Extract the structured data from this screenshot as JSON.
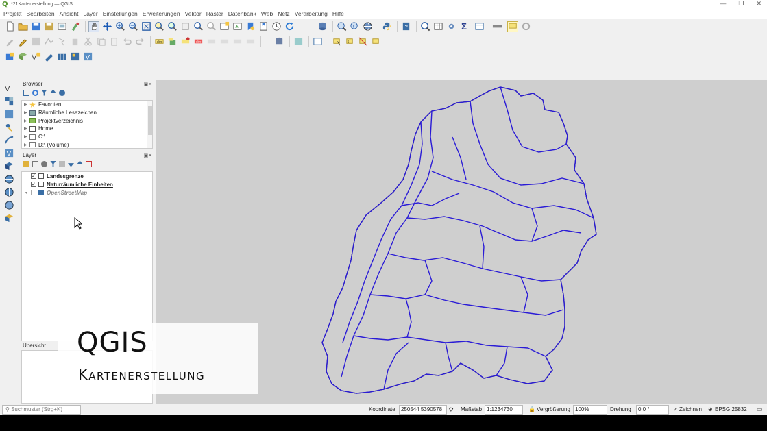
{
  "window": {
    "title": "*21Kartenerstellung — QGIS",
    "logo": "Q",
    "controls": [
      "—",
      "❐",
      "✕"
    ]
  },
  "menu": [
    "Projekt",
    "Bearbeiten",
    "Ansicht",
    "Layer",
    "Einstellungen",
    "Erweiterungen",
    "Vektor",
    "Raster",
    "Datenbank",
    "Web",
    "Netz",
    "Verarbeitung",
    "Hilfe"
  ],
  "browser": {
    "title": "Browser",
    "items": [
      "Favoriten",
      "Räumliche Lesezeichen",
      "Projektverzeichnis",
      "Home",
      "C:\\",
      "D:\\ (Volume)"
    ]
  },
  "layers": {
    "title": "Layer",
    "items": [
      {
        "label": "Landesgrenze",
        "checked": true
      },
      {
        "label": "Naturräumliche Einheiten",
        "checked": true
      },
      {
        "label": "OpenStreetMap",
        "checked": false
      }
    ]
  },
  "overview": {
    "title": "Übersicht"
  },
  "overlay": {
    "title": "QGIS",
    "subtitle": "Kartenerstellung"
  },
  "status": {
    "search_placeholder": "Suchmuster (Strg+K)",
    "coord_label": "Koordinate",
    "coord_value": "250544 5390578",
    "scale_label": "Maßstab",
    "scale_value": "1:1234730",
    "magnifier_label": "Vergrößerung",
    "magnifier_value": "100%",
    "rotation_label": "Drehung",
    "rotation_value": "0,0 °",
    "render_label": "Zeichnen",
    "crs": "EPSG:25832"
  },
  "colors": {
    "region_lines": "#2a1bd6",
    "border_line": "#222222",
    "canvas_bg": "#cfcfcf"
  }
}
